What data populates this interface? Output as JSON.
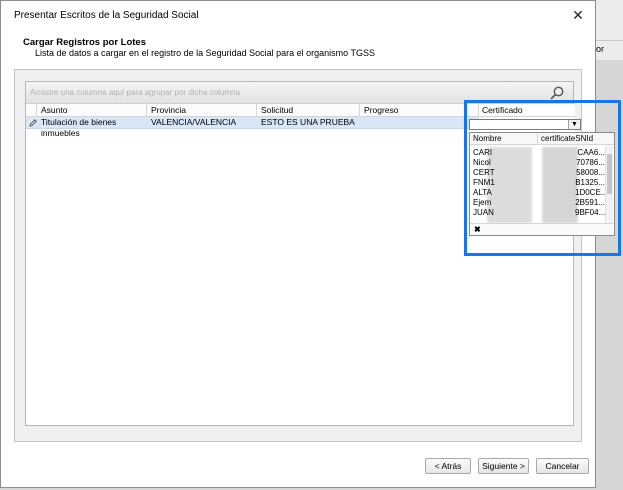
{
  "window": {
    "title": "Presentar Escritos de la Seguridad Social",
    "close_glyph": "✕"
  },
  "background": {
    "partial_text": "or"
  },
  "header": {
    "title": "Cargar Registros por Lotes",
    "subtitle": "Lista de datos a cargar en el registro de la Seguridad Social para el organismo TGSS"
  },
  "grid": {
    "group_panel_text": "Arrastre una columna aquí para agrupar por dicha columna",
    "columns": [
      "Asunto",
      "Provincia",
      "Solicitud",
      "Progreso",
      "Certificado"
    ],
    "rows": [
      {
        "asunto": "Titulación de bienes inmuebles",
        "provincia": "VALENCIA/VALENCIA",
        "solicitud": "ESTO ES UNA PRUEBA",
        "progreso": "",
        "certificado": ""
      }
    ]
  },
  "certificate_dropdown": {
    "columns": [
      "Nombre",
      "certificateSNId"
    ],
    "items": [
      {
        "nombre": "CARI",
        "sn": "CAA6..."
      },
      {
        "nombre": "Nicol",
        "sn": "70786..."
      },
      {
        "nombre": "CERT",
        "sn": "58008..."
      },
      {
        "nombre": "FNM1",
        "sn": "B1325..."
      },
      {
        "nombre": "ALTA",
        "sn": "1D0CE..."
      },
      {
        "nombre": "Ejem",
        "sn": "2B591..."
      },
      {
        "nombre": "JUAN",
        "sn": "9BF04..."
      }
    ],
    "clear_glyph": "✖"
  },
  "buttons": {
    "back": "< Atrás",
    "next": "Siguiente >",
    "cancel": "Cancelar"
  },
  "colors": {
    "highlight": "#1a75e8",
    "selected_row": "#d8e6f6"
  }
}
